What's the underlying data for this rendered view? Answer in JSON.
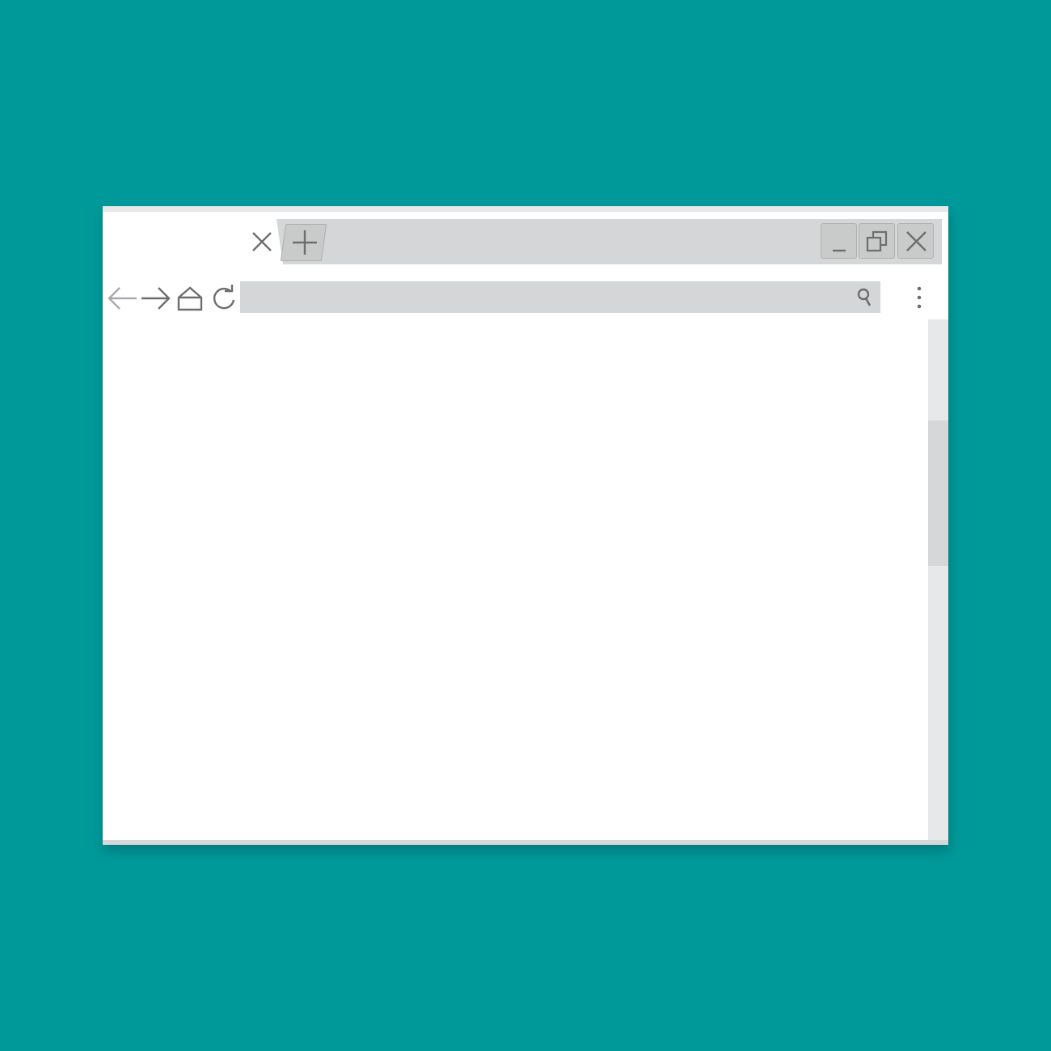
{
  "colors": {
    "background": "#00999a",
    "window": "#ffffff",
    "tab_bar": "#d5d6d7",
    "button_fill": "#c9caca",
    "address_bar": "#d5d6d7",
    "scrollbar_track": "#e7e8e9",
    "scrollbar_thumb": "#d6d7d8",
    "icon_stroke": "#6d6e70",
    "back_icon_stroke": "#a7a9ac"
  },
  "tab_strip": {
    "close_tab_icon": "close-icon",
    "new_tab_icon": "plus-icon"
  },
  "window_controls": {
    "minimize_icon": "minimize-icon",
    "restore_icon": "restore-icon",
    "close_icon": "close-icon"
  },
  "toolbar": {
    "back_icon": "arrow-left-icon",
    "forward_icon": "arrow-right-icon",
    "home_icon": "home-icon",
    "reload_icon": "reload-icon",
    "menu_icon": "kebab-menu-icon"
  },
  "address_bar": {
    "value": "",
    "placeholder": "",
    "search_icon": "search-icon"
  },
  "scrollbar": {
    "position_fraction": 0.27
  }
}
